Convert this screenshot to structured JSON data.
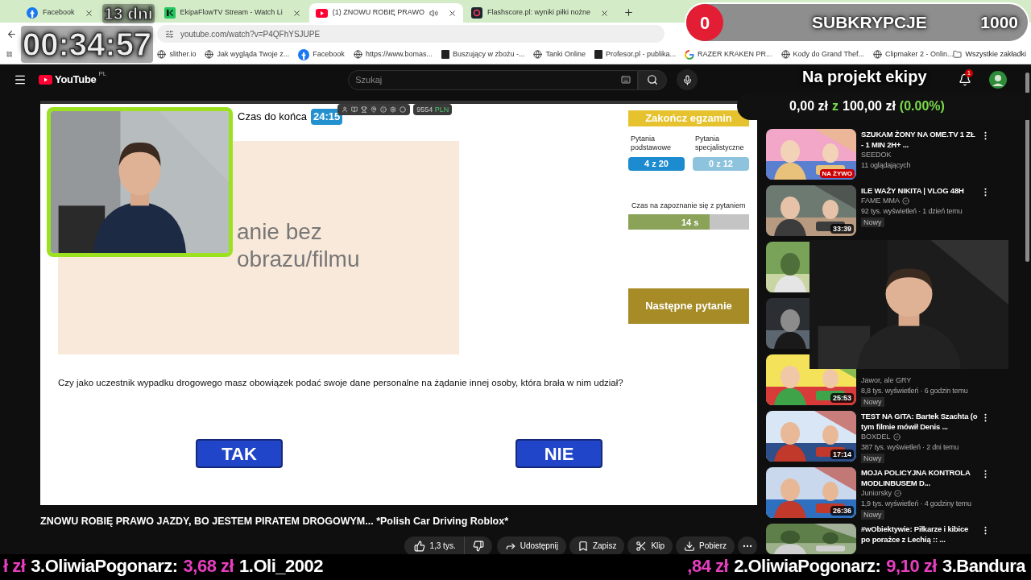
{
  "browser": {
    "tabs": [
      {
        "title": "Facebook",
        "kind": "facebook",
        "selected": false,
        "audio": false
      },
      {
        "title": "EkipaFlowTV Stream - Watch Li",
        "kind": "ekipa",
        "selected": false,
        "audio": false
      },
      {
        "title": "(1) ZNOWU ROBIĘ PRAWO",
        "kind": "youtube",
        "selected": true,
        "audio": true
      },
      {
        "title": "Flashscore.pl: wyniki piłki nożne",
        "kind": "flashscore",
        "selected": false,
        "audio": false
      }
    ],
    "url": "youtube.com/watch?v=P4QFhYSJUPE",
    "bookmarks": [
      {
        "label": "slither.io",
        "kind": "globe"
      },
      {
        "label": "Jak wygląda Twoje z...",
        "kind": "globe"
      },
      {
        "label": "Facebook",
        "kind": "facebook"
      },
      {
        "label": "https://www.bomas...",
        "kind": "globe"
      },
      {
        "label": "Buszujący w zbożu -...",
        "kind": "dark"
      },
      {
        "label": "Tanki Online",
        "kind": "globe"
      },
      {
        "label": "Profesor.pl - publika...",
        "kind": "dark"
      },
      {
        "label": "RAZER KRAKEN PR...",
        "kind": "google"
      },
      {
        "label": "Kody do Grand Thef...",
        "kind": "globe"
      },
      {
        "label": "Clipmaker 2 - Onlin...",
        "kind": "globe"
      }
    ],
    "all_bookmarks": "Wszystkie zakładki"
  },
  "youtube": {
    "logo": "YouTube",
    "region": "PL",
    "search": {
      "placeholder": "Szukaj"
    },
    "notifications": "1"
  },
  "quiz": {
    "timer_label": "Czas do końca",
    "timer": "24:15",
    "balance": "9554",
    "currency": "PLN",
    "image_text": "anie bez obrazu/filmu",
    "end_button": "Zakończ egzamin",
    "counters": [
      {
        "label": "Pytania podstawowe",
        "value": "4 z 20",
        "selected": true
      },
      {
        "label": "Pytania specjalistyczne",
        "value": "0 z 12",
        "selected": false
      }
    ],
    "reading": {
      "label": "Czas na zapoznanie się z pytaniem",
      "value": "14 s",
      "level": 0.67
    },
    "next_button": "Następne pytanie",
    "question": "Czy jako uczestnik wypadku drogowego masz obowiązek podać swoje dane personalne na żądanie innej osoby, która brała w nim udział?",
    "answers": [
      "TAK",
      "NIE"
    ]
  },
  "video": {
    "title": "ZNOWU ROBIĘ PRAWO JAZDY, BO JESTEM PIRATEM DROGOWYM... *Polish Car Driving Roblox*",
    "actions": [
      {
        "kind": "like",
        "label": "1,3 tys."
      },
      {
        "kind": "dislike"
      },
      {
        "kind": "share",
        "label": "Udostępnij"
      },
      {
        "kind": "save",
        "label": "Zapisz"
      },
      {
        "kind": "clip",
        "label": "Klip"
      },
      {
        "kind": "download",
        "label": "Pobierz"
      },
      {
        "kind": "more"
      }
    ]
  },
  "related": [
    {
      "kind": "video",
      "title": "SZUKAM ŻONY NA OME.TV 1 ZŁ - 1 MIN 2H+ ...",
      "channel": "SEEDOK",
      "verified": false,
      "meta": "11 oglądających",
      "live_badge": "NA ŻYWO",
      "menu": true
    },
    {
      "kind": "video",
      "title": "ILE WAŻY NIKITA | VLOG 48H",
      "channel": "FAME MMA",
      "verified": true,
      "meta": "92 tys. wyświetleń · 1 dzień temu",
      "badge": "Nowy",
      "duration": "33:39",
      "menu": true
    },
    {
      "kind": "covered"
    },
    {
      "kind": "covered"
    },
    {
      "kind": "video",
      "channel": "Jawor, ale GRY",
      "verified": false,
      "meta": "8,8 tys. wyświetleń · 6 godzin temu",
      "badge": "Nowy",
      "duration": "25:53",
      "menu": false
    },
    {
      "kind": "video",
      "title": "TEST NA GITA: Bartek Szachta (o tym filmie mówił Denis ...",
      "channel": "BOXDEL",
      "verified": true,
      "meta": "387 tys. wyświetleń · 2 dni temu",
      "badge": "Nowy",
      "duration": "17:14",
      "menu": true
    },
    {
      "kind": "video",
      "title": "MOJA POLICYJNA KONTROLA MODLINBUSEM D...",
      "channel": "Juniorsky",
      "verified": true,
      "meta": "1,9 tys. wyświetleń · 4 godziny temu",
      "badge": "Nowy",
      "duration": "26:36",
      "menu": true
    },
    {
      "kind": "video",
      "title": "#wObiektywie: Piłkarze i kibice po porażce z Lechią :: ...",
      "menu": true
    }
  ],
  "overlay": {
    "countdown": "13 dni",
    "timer": "00:34:57",
    "subscriptions": {
      "count": "0",
      "label": "SUBKRYPCJE",
      "goal": "1000"
    },
    "fund": {
      "title": "Na projekt ekipy",
      "raised": "0,00 zł",
      "sep": "z",
      "target": "100,00 zł",
      "percent": "(0.00%)",
      "level": 0
    },
    "ticker_left": [
      {
        "kind": "amount",
        "text": "ł zł"
      },
      {
        "kind": "name",
        "text": "3.OliwiaPogonarz:"
      },
      {
        "kind": "amount",
        "text": "3,68 zł"
      },
      {
        "kind": "name",
        "text": "1.Oli_2002"
      }
    ],
    "ticker_right": [
      {
        "kind": "amount",
        "text": ",84 zł"
      },
      {
        "kind": "name",
        "text": "2.OliwiaPogonarz:"
      },
      {
        "kind": "amount",
        "text": "9,10 zł"
      },
      {
        "kind": "name",
        "text": "3.Bandura"
      }
    ]
  }
}
